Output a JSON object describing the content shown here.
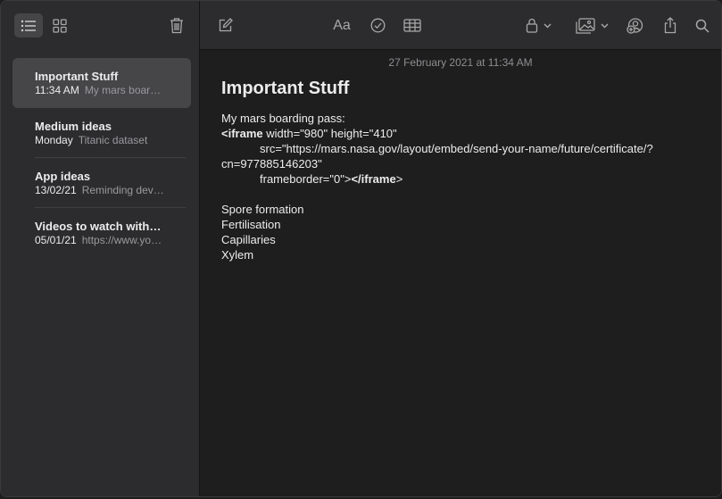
{
  "sidebar": {
    "notes": [
      {
        "title": "Important Stuff",
        "date": "11:34 AM",
        "preview": "My mars boar…",
        "selected": true
      },
      {
        "title": "Medium ideas",
        "date": "Monday",
        "preview": "Titanic dataset",
        "selected": false
      },
      {
        "title": "App ideas",
        "date": "13/02/21",
        "preview": "Reminding dev…",
        "selected": false
      },
      {
        "title": "Videos to watch with…",
        "date": "05/01/21",
        "preview": "https://www.yo…",
        "selected": false
      }
    ]
  },
  "toolbar": {
    "format_label": "Aa"
  },
  "note": {
    "timestamp": "27 February 2021 at 11:34 AM",
    "title": "Important Stuff",
    "line1": "My mars boarding pass:",
    "line2_tag": "<iframe",
    "line2_rest": " width=\"980\" height=\"410\"",
    "line3": "src=\"https://mars.nasa.gov/layout/embed/send-your-name/future/certificate/?",
    "line4": "cn=977885146203\"",
    "line5_attr": "frameborder=\"0\">",
    "line5_tag": "</iframe",
    "line5_end": ">",
    "list": [
      "Spore formation",
      "Fertilisation",
      "Capillaries",
      "Xylem"
    ]
  }
}
